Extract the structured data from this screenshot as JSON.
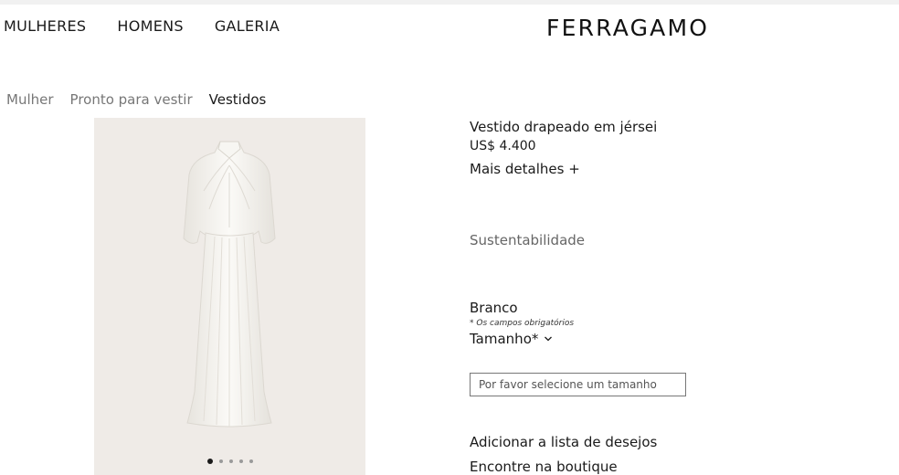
{
  "nav": {
    "items": [
      "MULHERES",
      "HOMENS",
      "GALERIA"
    ],
    "logo": "FERRAGAMO"
  },
  "breadcrumb": [
    "Mulher",
    "Pronto para vestir",
    "Vestidos"
  ],
  "product": {
    "name": "Vestido drapeado em jérsei",
    "price": "US$ 4.400",
    "more_details": "Mais detalhes +",
    "sustainability": "Sustentabilidade",
    "color": "Branco",
    "required_note": "* Os campos obrigatórios",
    "size_label": "Tamanho*",
    "size_placeholder": "Por favor selecione um tamanho",
    "wishlist": "Adicionar a lista de desejos",
    "boutique": "Encontre na boutique"
  },
  "gallery": {
    "image_count": 5,
    "active_index": 0,
    "background_color": "#efebe7",
    "dress_color": "#f6f5f1"
  }
}
